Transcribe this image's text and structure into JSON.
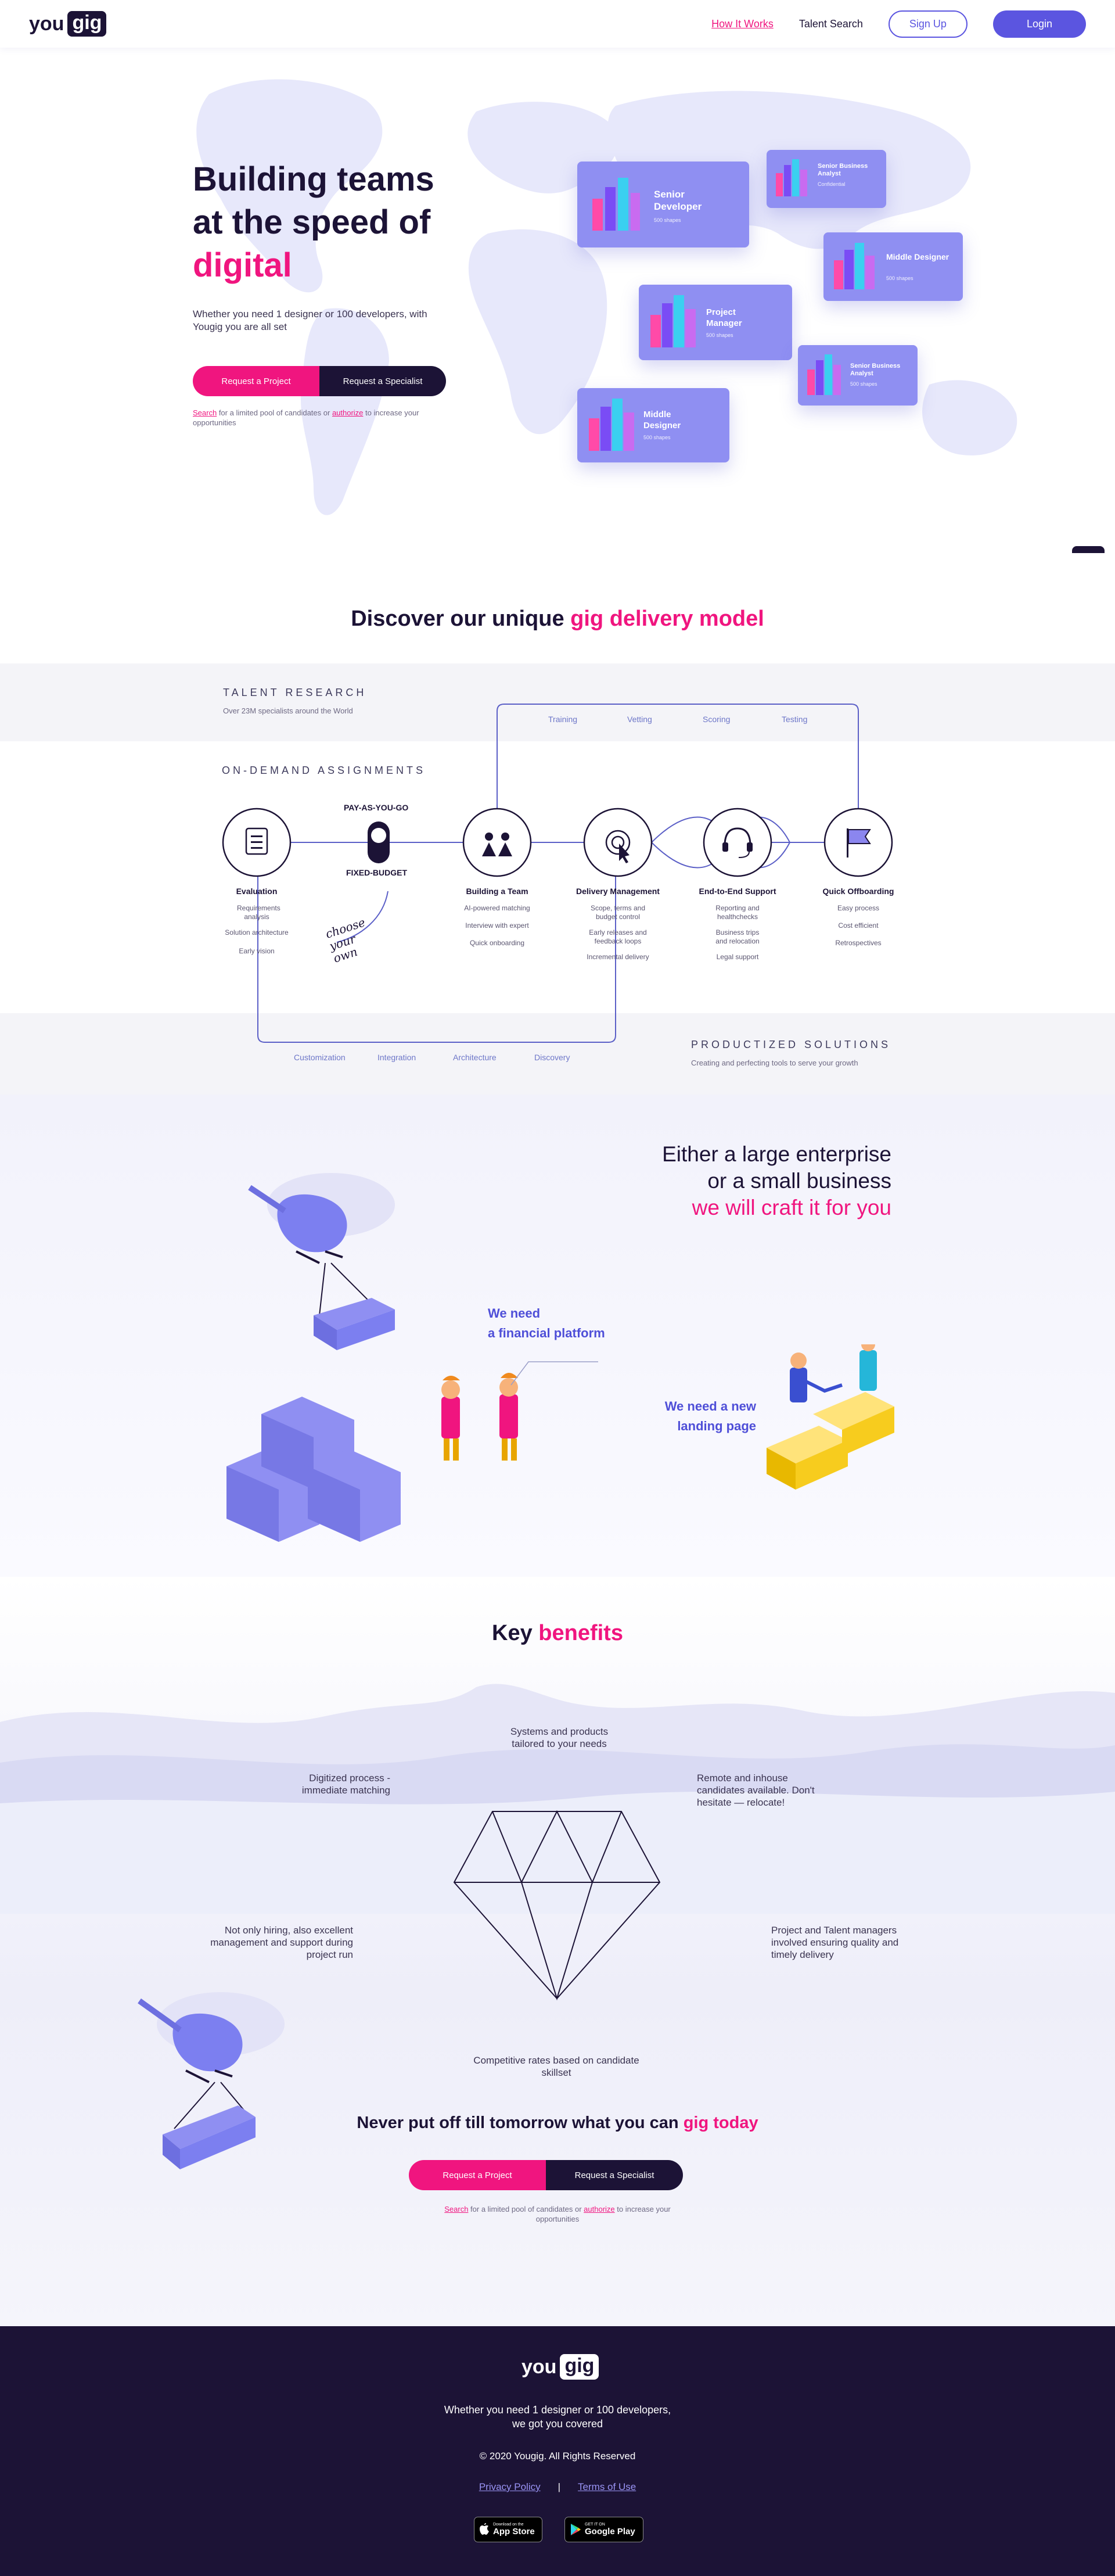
{
  "header": {
    "logo_you": "you",
    "logo_gig": "gig",
    "nav": {
      "how_it_works": "How It Works",
      "talent_search": "Talent Search",
      "sign_up": "Sign Up",
      "login": "Login"
    }
  },
  "hero": {
    "title_line1": "Building teams",
    "title_line2": "at the speed of",
    "title_accent": "digital",
    "subtitle": "Whether you need 1 designer or 100 developers, with Yougig you are all set",
    "cta_project": "Request a Project",
    "cta_specialist": "Request a Specialist",
    "note_link1": "Search",
    "note_mid": " for a limited pool of candidates or ",
    "note_link2": "authorize",
    "note_end": " to increase your opportunities",
    "cards": [
      {
        "title": "Senior Developer",
        "meta": "500 shapes"
      },
      {
        "title": "Senior Business Analyst",
        "meta": "Confidential"
      },
      {
        "title": "Middle Designer",
        "meta": "500 shapes"
      },
      {
        "title": "Project Manager",
        "meta": "500 shapes"
      },
      {
        "title": "Senior Business Analyst",
        "meta": "500 shapes"
      },
      {
        "title": "Middle Designer",
        "meta": "500 shapes"
      }
    ]
  },
  "discover": {
    "title": "Discover our unique ",
    "title_accent": "gig delivery model"
  },
  "model": {
    "talent_research": "TALENT RESEARCH",
    "talent_research_sub": "Over 23M specialists around the World",
    "on_demand": "ON-DEMAND ASSIGNMENTS",
    "productized": "PRODUCTIZED SOLUTIONS",
    "productized_sub": "Creating and perfecting tools to serve your growth",
    "top_loop": [
      "Training",
      "Vetting",
      "Scoring",
      "Testing"
    ],
    "bottom_loop": [
      "Customization",
      "Integration",
      "Architecture",
      "Discovery"
    ],
    "pay_as_you_go": "PAY-AS-YOU-GO",
    "fixed_budget": "FIXED-BUDGET",
    "choose_your_own": "choose your own",
    "stages": [
      {
        "title": "Evaluation",
        "items": [
          "Requirements analysis",
          "Solution architecture",
          "Early vision"
        ]
      },
      {
        "title": "Building a Team",
        "items": [
          "AI-powered matching",
          "Interview with expert",
          "Quick onboarding"
        ]
      },
      {
        "title": "Delivery Management",
        "items": [
          "Scope, terms and budget control",
          "Early releases and feedback loops",
          "Incremental delivery"
        ]
      },
      {
        "title": "End-to-End Support",
        "items": [
          "Reporting and healthchecks",
          "Business trips and relocation",
          "Legal support"
        ]
      },
      {
        "title": "Quick Offboarding",
        "items": [
          "Easy process",
          "Cost efficient",
          "Retrospectives"
        ]
      }
    ]
  },
  "enterprise": {
    "line1": "Either a large enterprise",
    "line2": "or a small business",
    "accent": "we will craft it for you",
    "speech1_line1": "We need",
    "speech1_line2": "a financial platform",
    "speech2_line1": "We need a new",
    "speech2_line2": "landing page"
  },
  "benefits": {
    "title": "Key ",
    "title_accent": "benefits",
    "items": {
      "top": "Systems and products tailored to your needs",
      "left_top": "Digitized process - immediate matching",
      "right_top": "Remote and inhouse candidates available. Don't hesitate — relocate!",
      "left_bottom": "Not only hiring, also excellent management and support during project run",
      "right_bottom": "Project and Talent managers involved ensuring quality and timely delivery",
      "bottom": "Competitive rates based on candidate skillset"
    },
    "cta_title": "Never put off till tomorrow what you can ",
    "cta_accent": "gig today",
    "cta_project": "Request a Project",
    "cta_specialist": "Request a Specialist",
    "note_link1": "Search",
    "note_mid": " for a limited pool of candidates or ",
    "note_link2": "authorize",
    "note_end": " to increase your opportunities"
  },
  "footer": {
    "tagline_line1": "Whether you need 1 designer or 100 developers,",
    "tagline_line2": "we got you covered",
    "copyright": "© 2020 Yougig. All Rights Reserved",
    "privacy": "Privacy Policy",
    "separator": "|",
    "terms": "Terms of Use",
    "app_store_small": "Download on the",
    "app_store_big": "App Store",
    "google_play_small": "GET IT ON",
    "google_play_big": "Google Play"
  },
  "colors": {
    "pink": "#f0157f",
    "dark": "#1c1336",
    "indigo": "#5b55e0",
    "card": "#8f8ff2"
  }
}
